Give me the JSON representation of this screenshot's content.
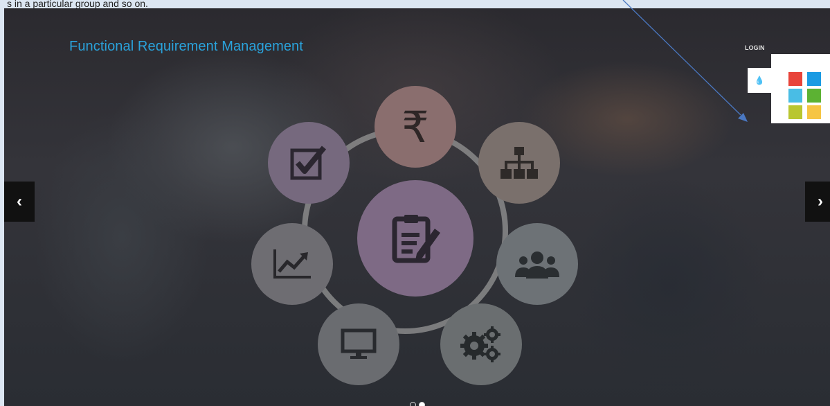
{
  "doc_text": "s in a particular group and so on.",
  "header": {
    "title": "Functional Requirement Management",
    "login_label": "LOGIN"
  },
  "carousel": {
    "prev_glyph": "‹",
    "next_glyph": "›",
    "slides": 2,
    "active_slide": 1
  },
  "theme_switcher": {
    "drop_glyph": "💧",
    "swatches": [
      "#e8443a",
      "#1a9be3",
      "#49bde5",
      "#5cb233",
      "#b9c630",
      "#f6c544"
    ]
  },
  "diagram": {
    "center_icon": "clipboard-edit-icon",
    "nodes": [
      {
        "icon": "rupee-icon",
        "glyph": "₹"
      },
      {
        "icon": "org-chart-icon"
      },
      {
        "icon": "team-icon"
      },
      {
        "icon": "gears-icon"
      },
      {
        "icon": "monitor-icon"
      },
      {
        "icon": "line-chart-icon"
      },
      {
        "icon": "checkbox-icon"
      }
    ]
  }
}
